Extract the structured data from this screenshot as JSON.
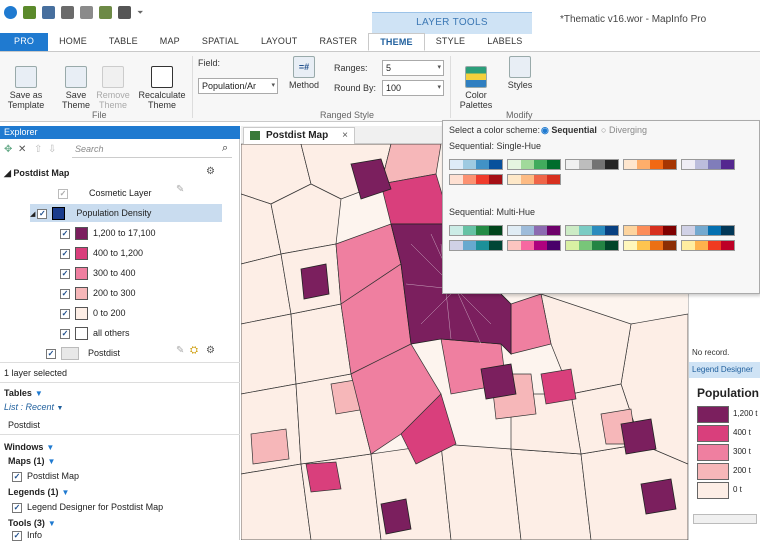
{
  "window": {
    "title": "*Thematic v16.wor - MapInfo Pro",
    "context_band": "LAYER TOOLS"
  },
  "tabs": [
    "PRO",
    "HOME",
    "TABLE",
    "MAP",
    "SPATIAL",
    "LAYOUT",
    "RASTER",
    "THEME",
    "STYLE",
    "LABELS"
  ],
  "ribbon": {
    "save_as_template": "Save as\nTemplate",
    "save_theme": "Save\nTheme",
    "remove_theme": "Remove\nTheme",
    "recalculate_theme": "Recalculate\nTheme",
    "file_group": "File",
    "field_label": "Field:",
    "field_value": "Population/Ar",
    "method": "Method",
    "ranges_label": "Ranges:",
    "ranges_value": "5",
    "round_by_label": "Round By:",
    "round_by_value": "100",
    "ranged_style_group": "Ranged Style",
    "color_palettes": "Color\nPalettes",
    "styles": "Styles",
    "modify_group": "Modify"
  },
  "explorer": {
    "title": "Explorer",
    "search_placeholder": "Search",
    "map_name": "Postdist Map",
    "cosmetic_layer": "Cosmetic Layer",
    "theme_layer": "Population Density",
    "ranges": [
      {
        "label": "1,200 to 17,100",
        "color": "#7b1f5e"
      },
      {
        "label": "400 to 1,200",
        "color": "#d93f7c"
      },
      {
        "label": "300 to 400",
        "color": "#ef7fa0"
      },
      {
        "label": "200 to 300",
        "color": "#f6b7b9"
      },
      {
        "label": "0 to 200",
        "color": "#fdeee6"
      },
      {
        "label": "all others",
        "color": "#ffffff"
      }
    ],
    "base_layer": "Postdist",
    "status": "1 layer selected",
    "tables_title": "Tables",
    "tables_list": "List : Recent",
    "tables_item": "Postdist",
    "windows_title": "Windows",
    "maps_title": "Maps (1)",
    "maps_item": "Postdist Map",
    "legends_title": "Legends (1)",
    "legends_item": "Legend Designer for Postdist Map",
    "tools_title": "Tools (3)",
    "tools_item": "Info"
  },
  "map_tab": {
    "label": "Postdist Map",
    "close": "×"
  },
  "palette_popup": {
    "select_label": "Select a color scheme:",
    "sequential": "Sequential",
    "diverging": "Diverging",
    "single_hue_title": "Sequential: Single-Hue",
    "multi_hue_title": "Sequential: Multi-Hue",
    "single_hue": [
      [
        "#deebf7",
        "#9ecae1",
        "#4292c6",
        "#08519c"
      ],
      [
        "#e5f5e0",
        "#a1d99b",
        "#41ab5d",
        "#006d2c"
      ],
      [
        "#f0f0f0",
        "#bdbdbd",
        "#737373",
        "#252525"
      ],
      [
        "#fee6ce",
        "#fdae6b",
        "#f16913",
        "#a63603"
      ],
      [
        "#efedf5",
        "#bcbddc",
        "#807dba",
        "#54278f"
      ],
      [
        "#fee0d2",
        "#fc9272",
        "#ef3b2c",
        "#a50f15"
      ],
      [
        "#fee8c8",
        "#fdbb84",
        "#ef6548",
        "#d7301f"
      ]
    ],
    "multi_hue": [
      [
        "#ccece6",
        "#66c2a4",
        "#238b45",
        "#00441b"
      ],
      [
        "#e0ecf4",
        "#9ebcda",
        "#8c6bb1",
        "#6e016b"
      ],
      [
        "#ccebc5",
        "#7bccc4",
        "#2b8cbe",
        "#084081"
      ],
      [
        "#fdd49e",
        "#fc8d59",
        "#d7301f",
        "#7f0000"
      ],
      [
        "#d0d1e6",
        "#74a9cf",
        "#0570b0",
        "#023858"
      ],
      [
        "#d0d1e6",
        "#67a9cf",
        "#1c9099",
        "#014636"
      ],
      [
        "#fcc5c0",
        "#f768a1",
        "#ae017e",
        "#49006a"
      ],
      [
        "#d9f0a3",
        "#78c679",
        "#238443",
        "#004529"
      ],
      [
        "#fff7bc",
        "#fec44f",
        "#ec7014",
        "#8c2d04"
      ],
      [
        "#ffeda0",
        "#feb24c",
        "#f03b20",
        "#bd0026"
      ]
    ]
  },
  "right_panel": {
    "no_record": "No record.",
    "legend_tab": "Legend Designer",
    "legend_title": "Population",
    "legend_values": [
      "1,200 t",
      "400 t",
      "300 t",
      "200 t",
      "0 t"
    ]
  },
  "colors": {
    "accent": "#1f7ad0",
    "theme_dark": "#7b1f5e",
    "theme_mid": "#d93f7c"
  }
}
